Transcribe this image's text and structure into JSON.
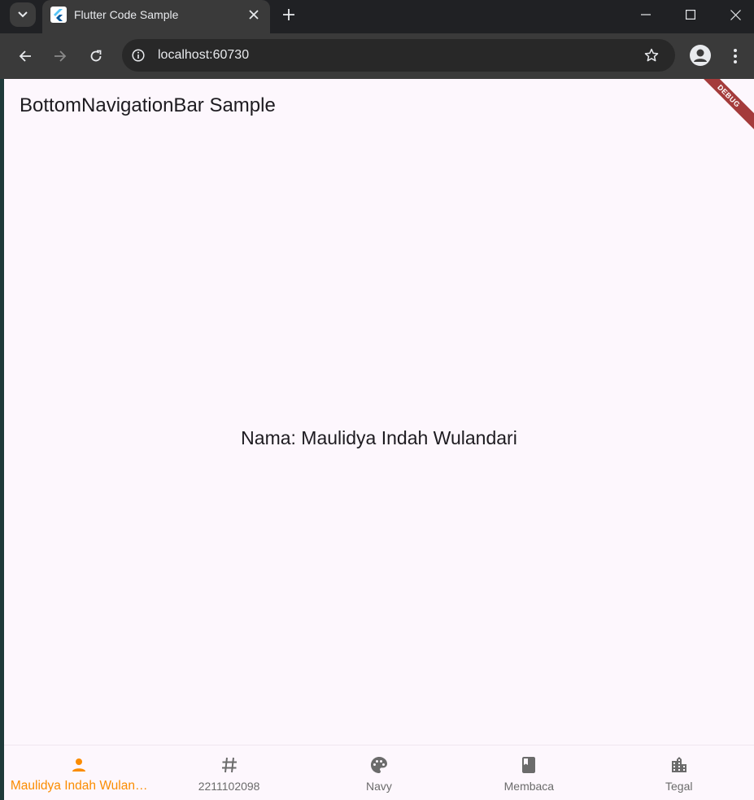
{
  "browser": {
    "tab_title": "Flutter Code Sample",
    "url": "localhost:60730"
  },
  "app": {
    "title": "BottomNavigationBar Sample",
    "debug_banner": "DEBUG",
    "content_text": "Nama: Maulidya Indah Wulandari",
    "accent_color": "#fb8c00",
    "inactive_color": "#6b6b6b",
    "bottom_nav": {
      "selected_index": 0,
      "items": [
        {
          "label": "Maulidya Indah Wulan…",
          "icon": "person-icon"
        },
        {
          "label": "2211102098",
          "icon": "hash-icon"
        },
        {
          "label": "Navy",
          "icon": "palette-icon"
        },
        {
          "label": "Membaca",
          "icon": "book-icon"
        },
        {
          "label": "Tegal",
          "icon": "city-icon"
        }
      ]
    }
  }
}
